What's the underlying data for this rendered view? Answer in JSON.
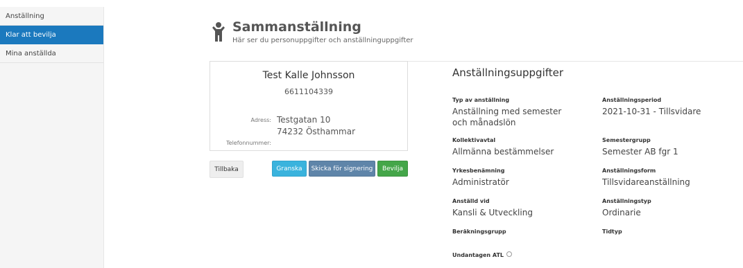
{
  "sidebar": {
    "items": [
      {
        "label": "Anställning"
      },
      {
        "label": "Klar att bevilja",
        "active": true
      },
      {
        "label": "Mina anställda"
      }
    ]
  },
  "header": {
    "icon": "person-icon",
    "title": "Sammanställning",
    "subtitle": "Här ser du personuppgifter och anställninguppgifter"
  },
  "person": {
    "name": "Test Kalle Johnsson",
    "pnr": "6611104339",
    "address_label": "Adress:",
    "address_line1": "Testgatan 10",
    "address_line2": "74232 Östhammar",
    "phone_label": "Telefonnummer:"
  },
  "actions": {
    "back": "Tillbaka",
    "review": "Granska",
    "send_for_signing": "Skicka för signering",
    "approve": "Bevilja"
  },
  "employment": {
    "title": "Anställningsuppgifter",
    "fields": {
      "type_label": "Typ av anställning",
      "type_value": "Anställning med semester och månadslön",
      "period_label": "Anställningsperiod",
      "period_value": "2021-10-31 - Tillsvidare",
      "agreement_label": "Kollektivavtal",
      "agreement_value": "Allmänna bestämmelser",
      "vacation_group_label": "Semestergrupp",
      "vacation_group_value": "Semester AB fgr 1",
      "title_label": "Yrkesbenämning",
      "title_value": "Administratör",
      "form_label": "Anställningsform",
      "form_value": "Tillsvidareanställning",
      "employed_at_label": "Anställd vid",
      "employed_at_value": "Kansli & Utveckling",
      "emp_type_label": "Anställningstyp",
      "emp_type_value": "Ordinarie",
      "calc_group_label": "Beräkningsgrupp",
      "time_type_label": "Tidtyp",
      "atl_label": "Undantagen ATL"
    }
  },
  "colors": {
    "active_sidebar": "#1b79be",
    "review_button": "#3ab3dd",
    "sign_button": "#5f85a9",
    "approve_button": "#44a649"
  }
}
